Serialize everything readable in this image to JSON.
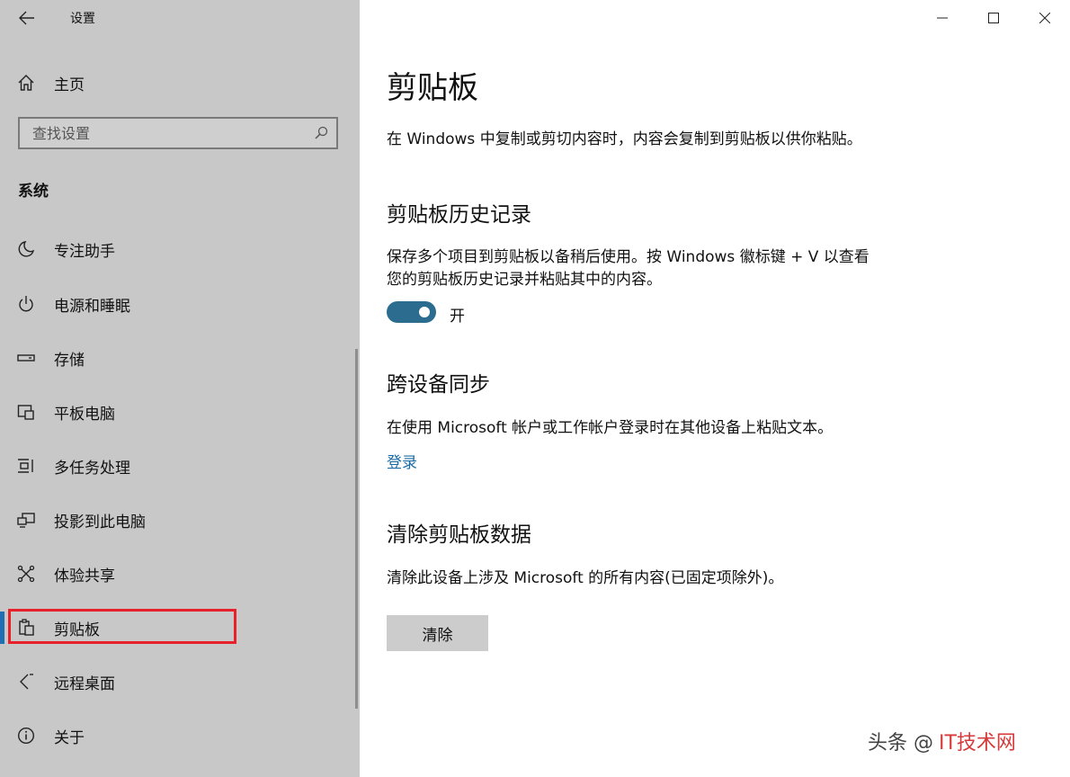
{
  "window": {
    "title": "设置",
    "controls": {
      "minimize": "minimize-icon",
      "maximize": "maximize-icon",
      "close": "close-icon"
    }
  },
  "sidebar": {
    "home_label": "主页",
    "search_placeholder": "查找设置",
    "section_title": "系统",
    "items": [
      {
        "label": "专注助手",
        "icon": "moon-icon"
      },
      {
        "label": "电源和睡眠",
        "icon": "power-icon"
      },
      {
        "label": "存储",
        "icon": "storage-icon"
      },
      {
        "label": "平板电脑",
        "icon": "tablet-icon"
      },
      {
        "label": "多任务处理",
        "icon": "multitasking-icon"
      },
      {
        "label": "投影到此电脑",
        "icon": "project-icon"
      },
      {
        "label": "体验共享",
        "icon": "share-icon"
      },
      {
        "label": "剪贴板",
        "icon": "clipboard-icon",
        "active": true
      },
      {
        "label": "远程桌面",
        "icon": "remote-desktop-icon"
      },
      {
        "label": "关于",
        "icon": "info-icon"
      }
    ],
    "colors": {
      "background": "#c8c8c8",
      "active_bar": "#1f6fb4",
      "highlight": "#e8202a"
    }
  },
  "main": {
    "title": "剪贴板",
    "description": "在 Windows 中复制或剪切内容时，内容会复制到剪贴板以供你粘贴。",
    "history": {
      "heading": "剪贴板历史记录",
      "text_line1": "保存多个项目到剪贴板以备稍后使用。按 Windows 徽标键 + V 以查看",
      "text_line2": "您的剪贴板历史记录并粘贴其中的内容。",
      "toggle_label": "开",
      "toggle_on": true
    },
    "sync": {
      "heading": "跨设备同步",
      "text": "在使用 Microsoft 帐户或工作帐户登录时在其他设备上粘贴文本。",
      "link": "登录"
    },
    "clear": {
      "heading": "清除剪贴板数据",
      "text": "清除此设备上涉及 Microsoft 的所有内容(已固定项除外)。",
      "button": "清除"
    },
    "colors": {
      "toggle": "#2c6c8e",
      "link": "#1a6ba6"
    }
  },
  "watermark": {
    "part1": "头条 @",
    "part2": "IT技术网"
  }
}
